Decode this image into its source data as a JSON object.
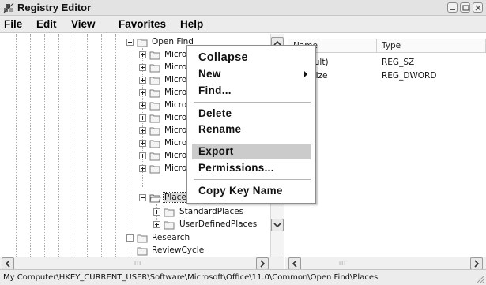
{
  "window": {
    "title": "Registry Editor"
  },
  "menubar": {
    "items": [
      "File",
      "Edit",
      "View",
      "Favorites",
      "Help"
    ]
  },
  "tree": {
    "items": [
      {
        "label": "Open Find",
        "expander": "minus"
      },
      {
        "label": "Microsc",
        "expander": "plus"
      },
      {
        "label": "Microsc",
        "expander": "plus"
      },
      {
        "label": "Microsc",
        "expander": "plus"
      },
      {
        "label": "Microsc",
        "expander": "plus"
      },
      {
        "label": "Microsc",
        "expander": "plus"
      },
      {
        "label": "Microsc",
        "expander": "plus"
      },
      {
        "label": "Microsc",
        "expander": "plus"
      },
      {
        "label": "Microsc",
        "expander": "plus"
      },
      {
        "label": "Microsc",
        "expander": "plus"
      },
      {
        "label": "Microsc",
        "expander": "plus"
      },
      {
        "label": "Places",
        "expander": "minus",
        "selected": true
      },
      {
        "label": "StandardPlaces",
        "expander": "plus"
      },
      {
        "label": "UserDefinedPlaces",
        "expander": "plus"
      },
      {
        "label": "Research",
        "expander": "plus"
      },
      {
        "label": "ReviewCycle",
        "expander": "none"
      }
    ]
  },
  "list": {
    "columns": [
      "Name",
      "Type"
    ],
    "rows": [
      {
        "name": "(Default)",
        "type": "REG_SZ"
      },
      {
        "name": "ItemSize",
        "type": "REG_DWORD"
      }
    ]
  },
  "context_menu": {
    "items": [
      {
        "label": "Collapse",
        "default": true
      },
      {
        "label": "New",
        "submenu": true
      },
      {
        "label": "Find..."
      },
      {
        "label": "Delete"
      },
      {
        "label": "Rename"
      },
      {
        "label": "Export",
        "highlighted": true
      },
      {
        "label": "Permissions..."
      },
      {
        "label": "Copy Key Name"
      }
    ]
  },
  "statusbar": {
    "path": "My Computer\\HKEY_CURRENT_USER\\Software\\Microsoft\\Office\\11.0\\Common\\Open Find\\Places"
  },
  "colors": {
    "menu_highlight": "#cbcbcb",
    "chrome": "#ececec",
    "window_bg": "#ffffff"
  }
}
